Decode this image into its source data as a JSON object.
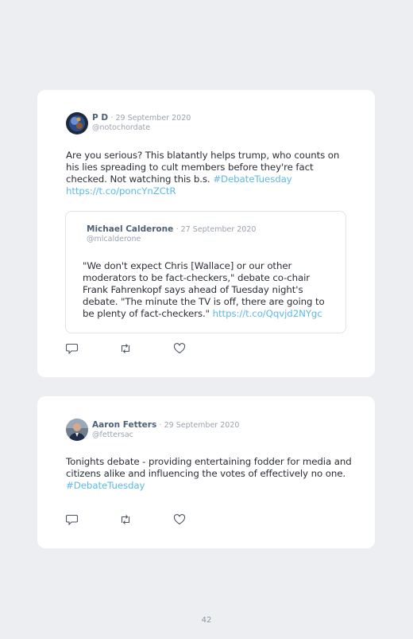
{
  "tweets": [
    {
      "author": "P D",
      "date": "· 29 September 2020",
      "handle": "@notochordate",
      "text": "Are you serious? This blatantly helps trump, who counts on his lies spreading to cult members before they're fact checked. Not watching this b.s.",
      "hashtag": "#DebateTuesday",
      "link": "https://t.co/poncYnZCtR",
      "quoted": {
        "author": "Michael Calderone",
        "date": "· 27 September 2020",
        "handle": "@mlcalderone",
        "text": "\"We don't expect Chris [Wallace] or our other moderators to be fact-checkers,\" debate co-chair Frank Fahrenkopf says ahead of Tuesday night's debate. \"The minute the TV is off, there are going to be plenty of fact-checkers.\"",
        "link": "https://t.co/Qqvjd2NYgc"
      }
    },
    {
      "author": "Aaron Fetters",
      "date": "· 29 September 2020",
      "handle": "@fettersac",
      "text": "Tonights debate - providing entertaining fodder for media and citizens alike and influencing the votes of effectively no one.",
      "hashtag": "#DebateTuesday"
    }
  ],
  "page_number": "42",
  "colors": {
    "link": "#5eb9e6",
    "name": "#4d6174",
    "meta": "#9aa3ad",
    "background": "#edeef2"
  },
  "icons": [
    "reply-icon",
    "retweet-icon",
    "like-icon"
  ]
}
